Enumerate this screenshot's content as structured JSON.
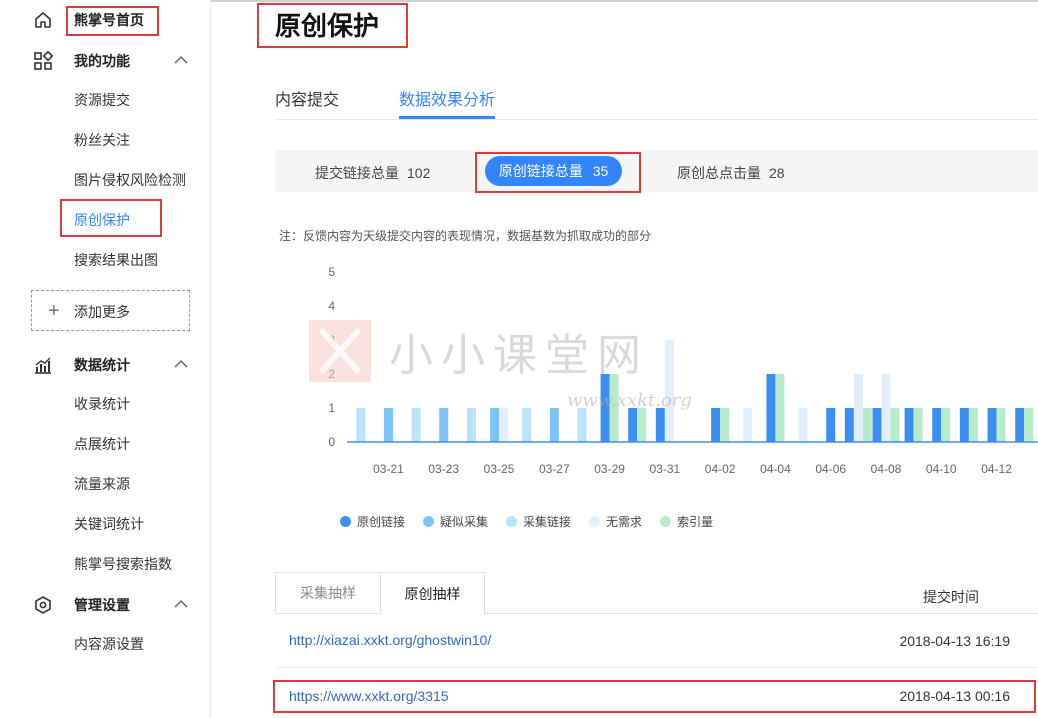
{
  "sidebar": {
    "home_label": "熊掌号首页",
    "sections": [
      {
        "label": "我的功能",
        "items": [
          "资源提交",
          "粉丝关注",
          "图片侵权风险检测",
          "原创保护",
          "搜索结果出图"
        ]
      },
      {
        "label": "数据统计",
        "items": [
          "收录统计",
          "点展统计",
          "流量来源",
          "关键词统计",
          "熊掌号搜索指数"
        ]
      },
      {
        "label": "管理设置",
        "items": [
          "内容源设置"
        ]
      }
    ],
    "add_more_label": "添加更多",
    "active_item": "原创保护"
  },
  "main": {
    "title": "原创保护",
    "tabs": [
      {
        "label": "内容提交",
        "active": false
      },
      {
        "label": "数据效果分析",
        "active": true
      }
    ],
    "stats": [
      {
        "label": "提交链接总量",
        "value": "102",
        "active": false
      },
      {
        "label": "原创链接总量",
        "value": "35",
        "active": true
      },
      {
        "label": "原创总点击量",
        "value": "28",
        "active": false
      }
    ],
    "note": "注：反馈内容为天级提交内容的表现情况，数据基数为抓取成功的部分"
  },
  "chart_data": {
    "type": "bar",
    "categories": [
      "03-20",
      "03-21",
      "03-22",
      "03-23",
      "03-24",
      "03-25",
      "03-26",
      "03-27",
      "03-28",
      "03-29",
      "03-30",
      "03-31",
      "04-01",
      "04-02",
      "04-03",
      "04-04",
      "04-05",
      "04-06",
      "04-07",
      "04-08",
      "04-09",
      "04-10",
      "04-11",
      "04-12",
      "04-13"
    ],
    "tick_labels": [
      "03-21",
      "03-23",
      "03-25",
      "03-27",
      "03-29",
      "03-31",
      "04-02",
      "04-04",
      "04-06",
      "04-08",
      "04-10",
      "04-12"
    ],
    "y_ticks": [
      "0",
      "1",
      "2",
      "3",
      "4",
      "5"
    ],
    "ylim": [
      0,
      5
    ],
    "series": [
      {
        "name": "原创链接",
        "color": "#3b8ff3",
        "values": [
          0,
          0,
          0,
          0,
          0,
          0,
          0,
          0,
          0,
          2,
          1,
          1,
          0,
          1,
          0,
          2,
          0,
          1,
          1,
          1,
          1,
          1,
          1,
          1,
          1
        ]
      },
      {
        "name": "疑似采集",
        "color": "#7cc4f8",
        "values": [
          0,
          1,
          0,
          1,
          0,
          1,
          0,
          1,
          0,
          0,
          0,
          0,
          0,
          0,
          0,
          0,
          0,
          0,
          0,
          0,
          0,
          0,
          0,
          0,
          0
        ]
      },
      {
        "name": "采集链接",
        "color": "#b9e3f8",
        "values": [
          1,
          0,
          1,
          0,
          1,
          0,
          1,
          0,
          1,
          0,
          0,
          0,
          0,
          0,
          0,
          0,
          0,
          0,
          0,
          0,
          0,
          0,
          0,
          0,
          0
        ]
      },
      {
        "name": "无需求",
        "color": "#e2eefb",
        "values": [
          0,
          0,
          0,
          0,
          0,
          1,
          0,
          0,
          0,
          0,
          0,
          3,
          0,
          0,
          1,
          0,
          1,
          0,
          2,
          2,
          0,
          0,
          0,
          0,
          0
        ]
      },
      {
        "name": "索引量",
        "color": "#b6ecc8",
        "values": [
          0,
          0,
          0,
          0,
          0,
          0,
          0,
          0,
          0,
          2,
          1,
          0,
          0,
          1,
          0,
          2,
          0,
          0,
          1,
          1,
          1,
          1,
          1,
          1,
          1
        ]
      }
    ]
  },
  "samples": {
    "tabs": [
      {
        "label": "采集抽样",
        "active": false
      },
      {
        "label": "原创抽样",
        "active": true
      }
    ],
    "column_header": "提交时间",
    "rows": [
      {
        "url": "http://xiazai.xxkt.org/ghostwin10/",
        "time": "2018-04-13 16:19"
      },
      {
        "url": "https://www.xxkt.org/3315",
        "time": "2018-04-13 00:16"
      }
    ]
  },
  "watermark": {
    "text": "小小课堂网",
    "url": "www.xxkt.org"
  }
}
